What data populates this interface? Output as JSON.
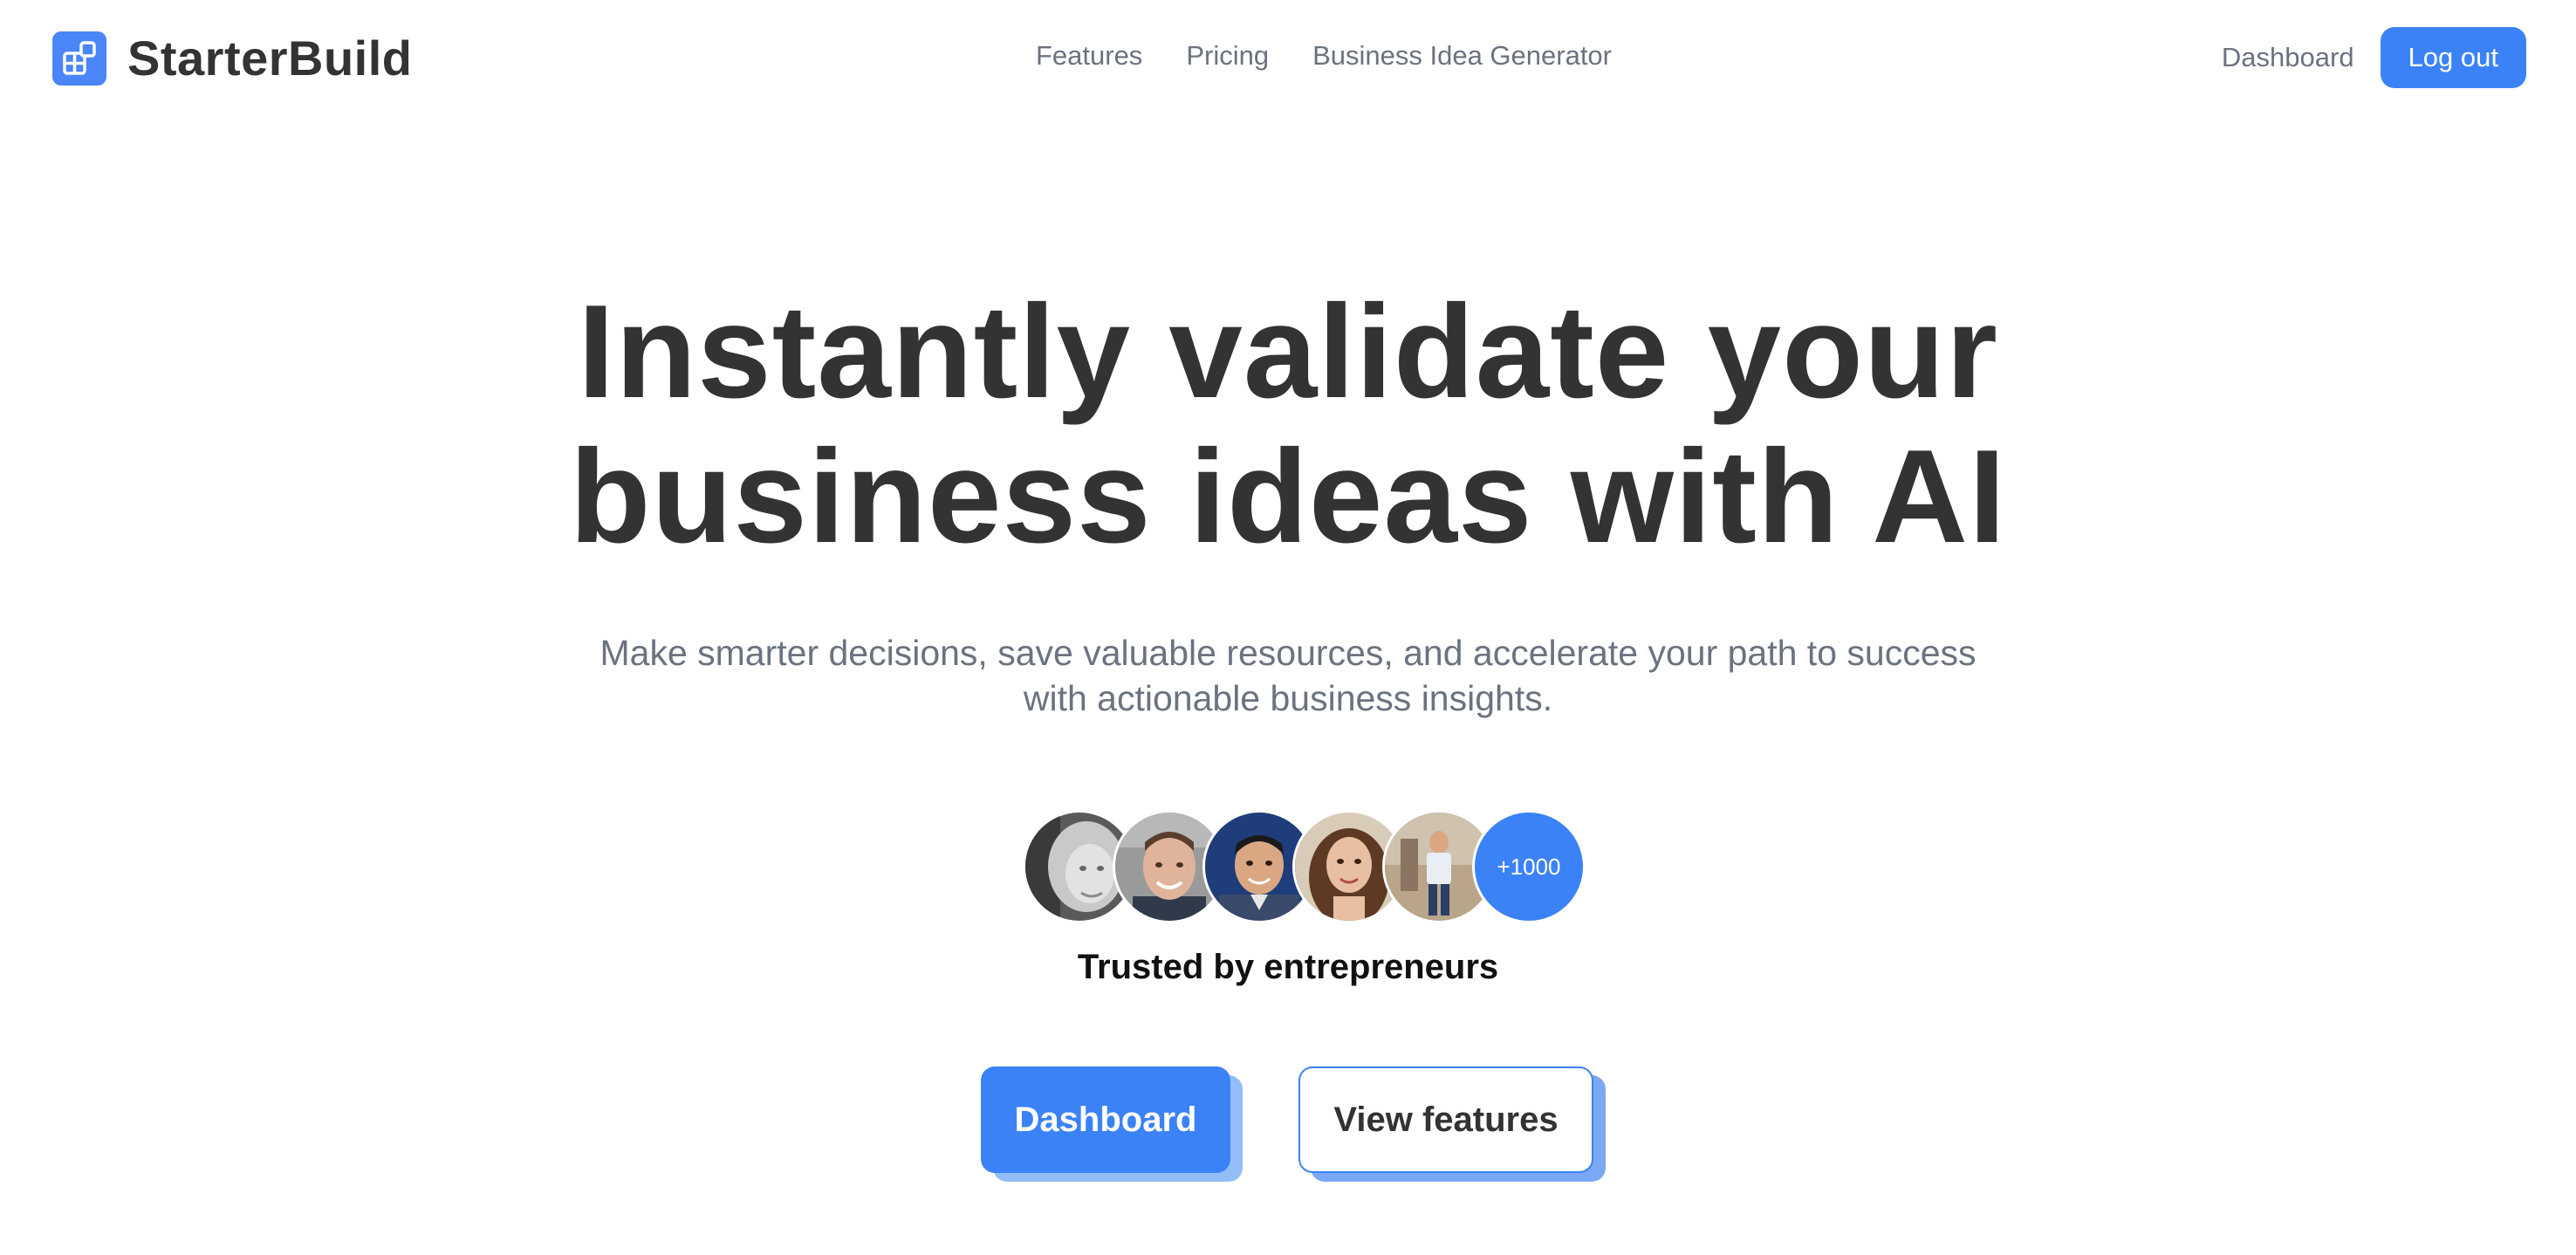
{
  "brand": {
    "name": "StarterBuild",
    "icon": "grid-logo-icon",
    "color": "#4a86f7"
  },
  "nav": {
    "items": [
      "Features",
      "Pricing",
      "Business Idea Generator"
    ]
  },
  "header": {
    "dashboard_label": "Dashboard",
    "logout_label": "Log out"
  },
  "hero": {
    "headline_line1": "Instantly validate your",
    "headline_line2": "business ideas with AI",
    "subheadline_line1": "Make smarter decisions, save valuable resources, and accelerate your path to success",
    "subheadline_line2": "with actionable business insights.",
    "avatar_count": "+1000",
    "trusted_label": "Trusted by entrepreneurs",
    "primary_cta": "Dashboard",
    "secondary_cta": "View features"
  },
  "colors": {
    "accent": "#3b82f6",
    "text_dark": "#333333",
    "text_muted": "#6b7280"
  }
}
